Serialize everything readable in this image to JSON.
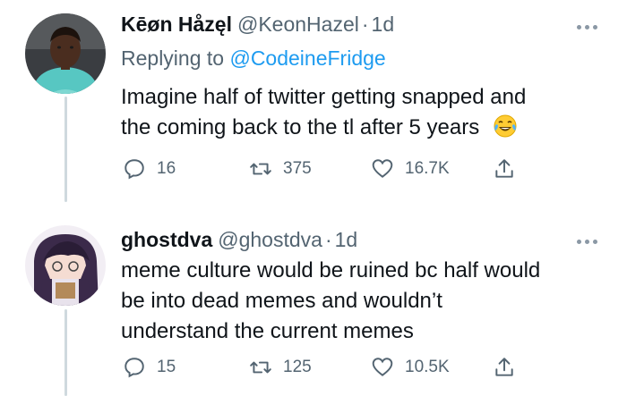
{
  "tweet1": {
    "display_name": "Kēøn Håzęl",
    "handle": "@KeonHazel",
    "separator": "·",
    "time": "1d",
    "replying_prefix": "Replying to ",
    "replying_to": "@CodeineFridge",
    "text_line1": "Imagine half of twitter getting snapped and",
    "text_line2": "the coming back to the tl after 5 years",
    "emoji": "😂",
    "replies": "16",
    "retweets": "375",
    "likes": "16.7K"
  },
  "tweet2": {
    "display_name": "ghostdva",
    "handle": "@ghostdva",
    "separator": "·",
    "time": "1d",
    "text_line1": "meme culture would be ruined bc half would",
    "text_line2": "be into dead memes and wouldn’t",
    "text_line3": "understand the current memes",
    "replies": "15",
    "retweets": "125",
    "likes": "10.5K"
  },
  "colors": {
    "secondary_text": "#536471",
    "link": "#1d9bf0",
    "thread_line": "#cfd9de"
  }
}
